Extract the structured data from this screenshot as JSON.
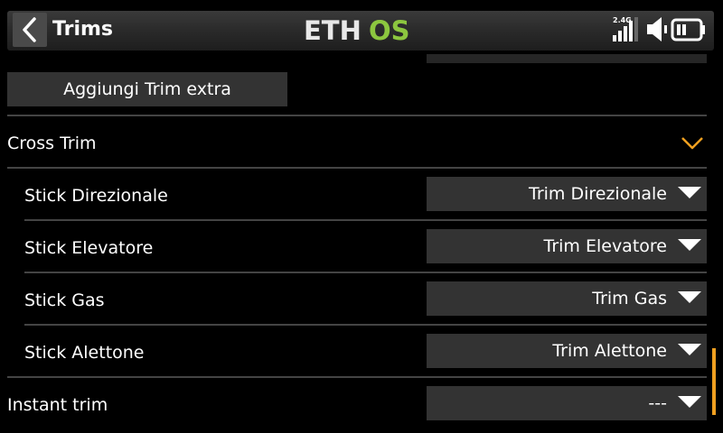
{
  "header": {
    "title": "Trims",
    "logo_left": "ETH",
    "logo_right": "OS",
    "band_label": "2.4G"
  },
  "extra_trim_button": "Aggiungi Trim extra",
  "cross_trim": {
    "label": "Cross Trim",
    "rows": [
      {
        "label": "Stick Direzionale",
        "value": "Trim Direzionale"
      },
      {
        "label": "Stick Elevatore",
        "value": "Trim Elevatore"
      },
      {
        "label": "Stick Gas",
        "value": "Trim Gas"
      },
      {
        "label": "Stick Alettone",
        "value": "Trim Alettone"
      }
    ]
  },
  "instant_trim": {
    "label": "Instant trim",
    "value": "---"
  },
  "colors": {
    "accent": "#f0a020",
    "logo_green": "#8cc63f",
    "background": "#000000",
    "control": "#333333"
  },
  "icons": [
    "back-arrow-icon",
    "signal-bars-icon",
    "speaker-icon",
    "battery-icon",
    "chevron-down-icon",
    "dropdown-arrow-icon"
  ]
}
